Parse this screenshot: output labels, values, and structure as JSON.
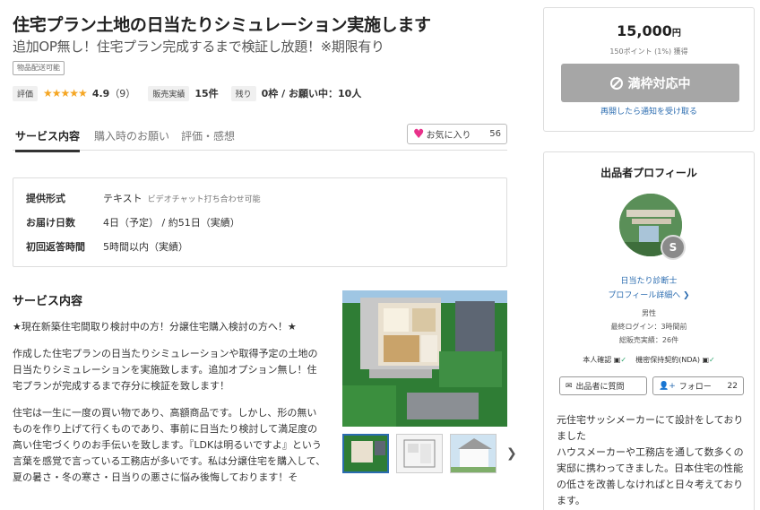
{
  "header": {
    "title": "住宅プラン土地の日当たりシミュレーション実施します",
    "subtitle": "追加OP無し！住宅プラン完成するまで検証し放題！※期限有り",
    "shipping_badge": "物品配送可能"
  },
  "stats": {
    "rating_label": "評価",
    "stars": "★★★★★",
    "rating": "4.9",
    "reviews": "（9）",
    "sales_label": "販売実績",
    "sales": "15件",
    "remain_label": "残り",
    "remain": "0枠 / お願い中：10人"
  },
  "tabs": [
    {
      "label": "サービス内容"
    },
    {
      "label": "購入時のお願い"
    },
    {
      "label": "評価・感想"
    }
  ],
  "favorite": {
    "label": "お気に入り",
    "count": "56"
  },
  "info": {
    "format_label": "提供形式",
    "format_value": "テキスト",
    "format_note": "ビデオチャット打ち合わせ可能",
    "delivery_label": "お届け日数",
    "delivery_value": "4日（予定） / 約51日（実績）",
    "response_label": "初回返答時間",
    "response_value": "5時間以内（実績）"
  },
  "service": {
    "heading": "サービス内容",
    "p1": "★現在新築住宅間取り検討中の方！分譲住宅購入検討の方へ！★",
    "p2": "作成した住宅プランの日当たりシミュレーションや取得予定の土地の日当たりシミュレーションを実施致します。追加オプション無し！住宅プランが完成するまで存分に検証を致します！",
    "p3": "住宅は一生に一度の買い物であり、高額商品です。しかし、形の無いものを作り上げて行くものであり、事前に日当たり検討して満足度の高い住宅づくりのお手伝いを致します。『LDKは明るいですよ』という言葉を感覚で言っている工務店が多いです。私は分譲住宅を購入して、夏の暑さ・冬の寒さ・日当りの悪さに悩み後悔しております！そ"
  },
  "purchase": {
    "price": "15,000",
    "yen": "円",
    "points": "150ポイント (1%) 獲得",
    "button": "満枠対応中",
    "notify": "再開したら通知を受け取る"
  },
  "profile": {
    "title": "出品者プロフィール",
    "rank": "S",
    "name": "日当たり診断士",
    "detail_link": "プロフィール詳細へ ❯",
    "gender": "男性",
    "last_login": "最終ログイン：3時間前",
    "total_sales": "総販売実績：26件",
    "identity": "本人確認",
    "nda": "機密保持契約(NDA)",
    "question_button": "出品者に質問",
    "follow_button": "フォロー",
    "follow_count": "22",
    "bio": "元住宅サッシメーカーにて設計をしておりました\nハウスメーカーや工務店を通して数多くの実邸に携わってきました。日本住宅の性能の低さを改善しなければと日々考えております。"
  },
  "colors": {
    "accent": "#2b6cb0",
    "star": "#f5a623",
    "heart": "#e8318a",
    "disabled_button": "#a6a6a6"
  }
}
